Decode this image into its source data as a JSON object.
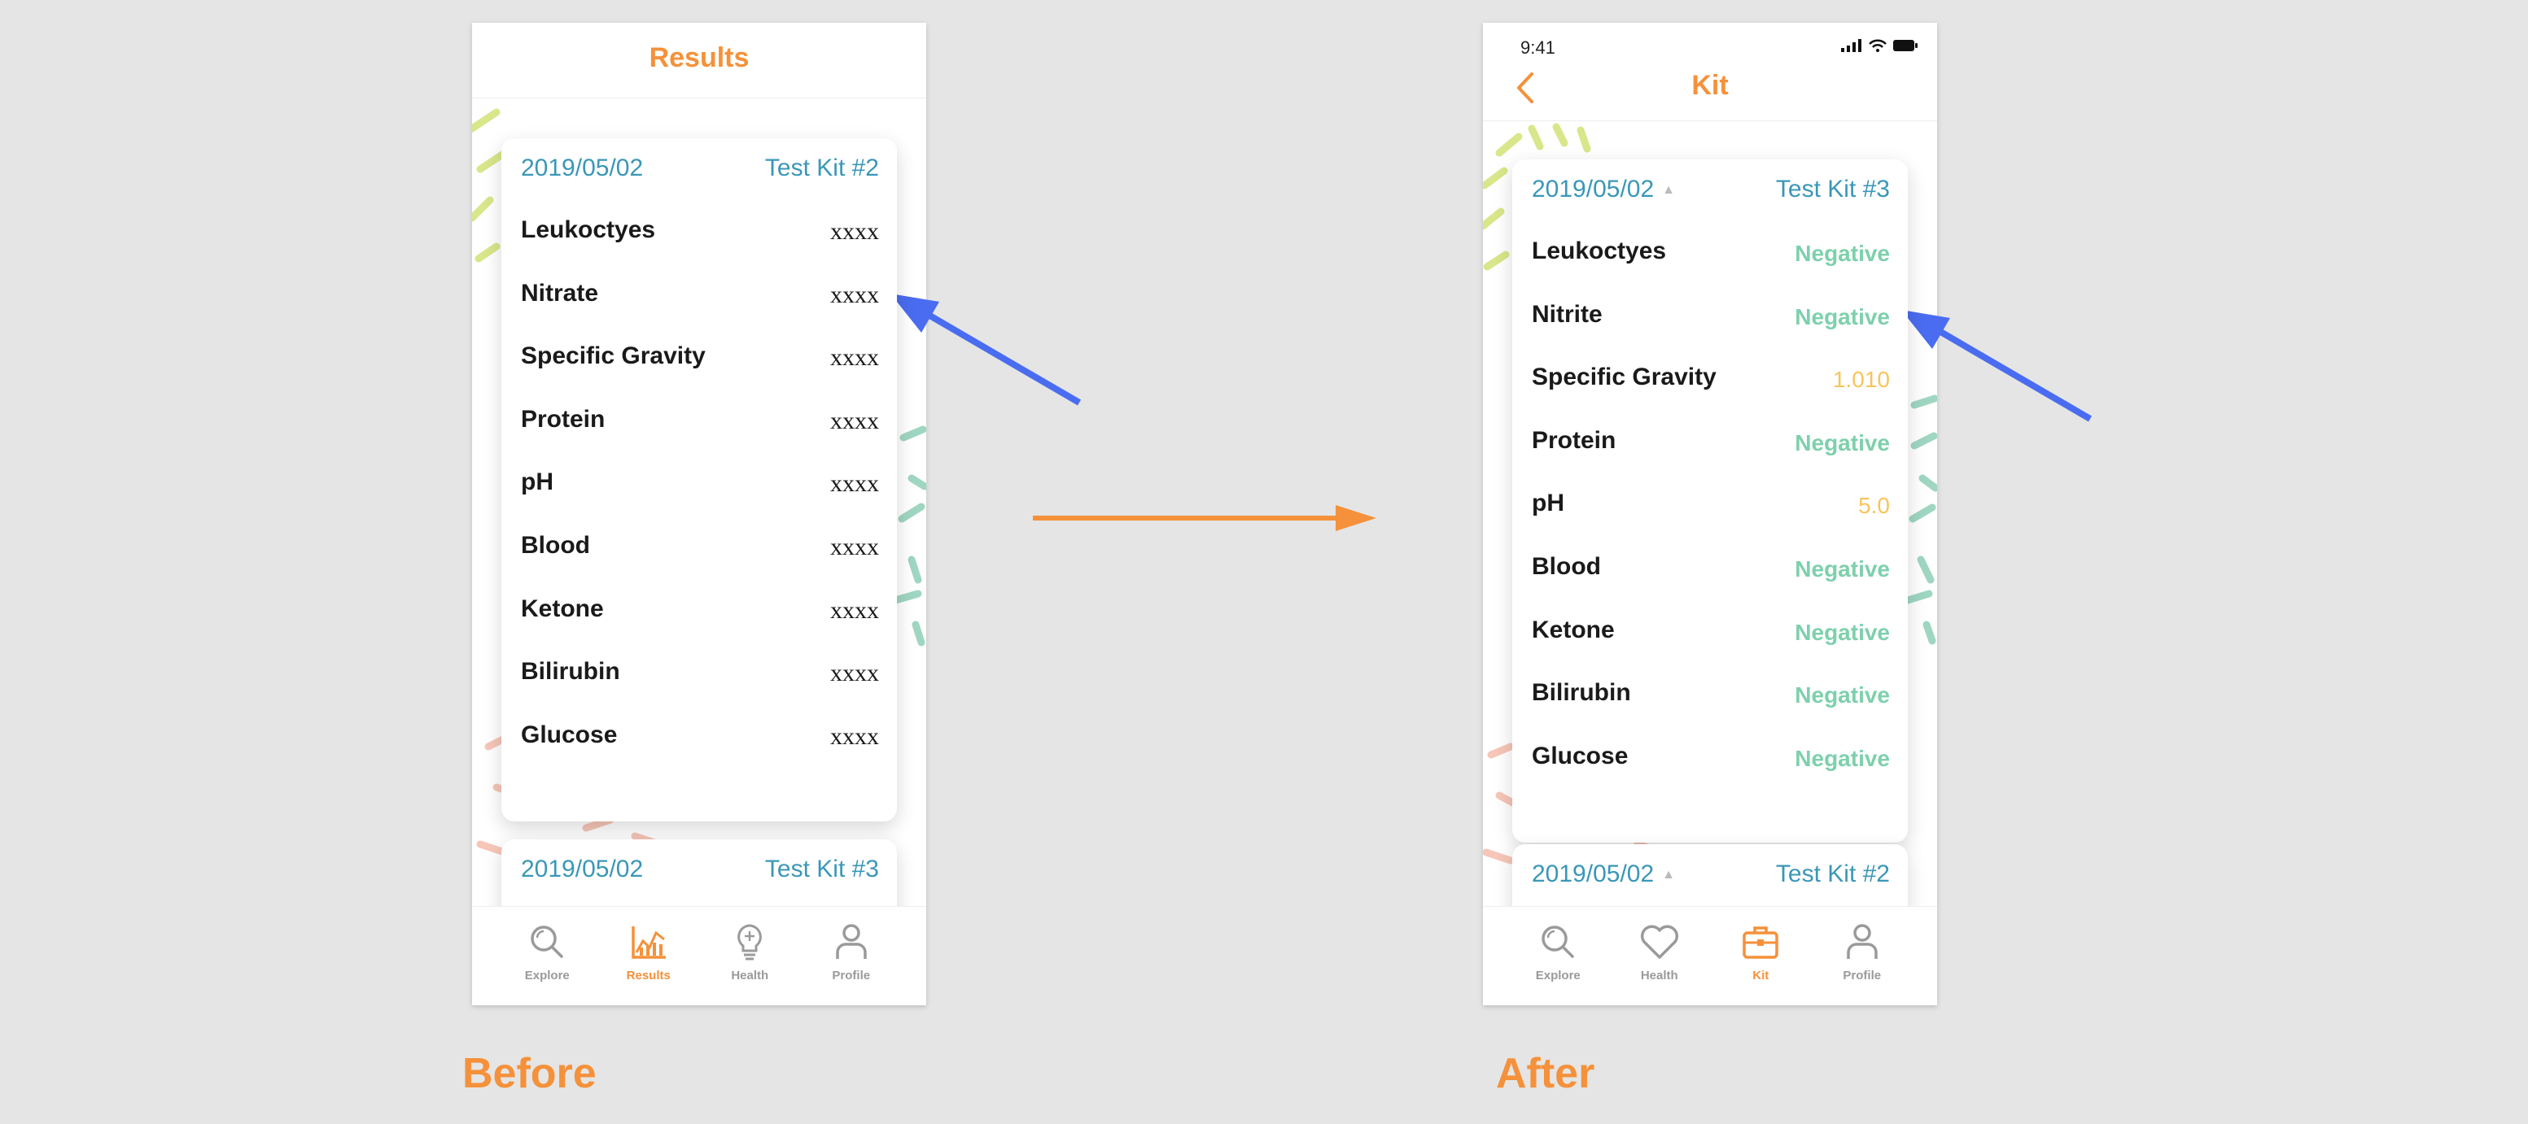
{
  "before": {
    "caption": "Before",
    "header_title": "Results",
    "card_main": {
      "date": "2019/05/02",
      "kit": "Test Kit #2"
    },
    "card_second": {
      "date": "2019/05/02",
      "kit": "Test Kit #3"
    },
    "rows": [
      {
        "label": "Leukoctyes",
        "value": "xxxx"
      },
      {
        "label": "Nitrate",
        "value": "xxxx"
      },
      {
        "label": "Specific Gravity",
        "value": "xxxx"
      },
      {
        "label": "Protein",
        "value": "xxxx"
      },
      {
        "label": "pH",
        "value": "xxxx"
      },
      {
        "label": "Blood",
        "value": "xxxx"
      },
      {
        "label": "Ketone",
        "value": "xxxx"
      },
      {
        "label": "Bilirubin",
        "value": "xxxx"
      },
      {
        "label": "Glucose",
        "value": "xxxx"
      }
    ],
    "tabs": [
      {
        "label": "Explore",
        "icon": "magnifier-icon",
        "active": false
      },
      {
        "label": "Results",
        "icon": "chart-icon",
        "active": true
      },
      {
        "label": "Health",
        "icon": "lightbulb-icon",
        "active": false
      },
      {
        "label": "Profile",
        "icon": "person-icon",
        "active": false
      }
    ]
  },
  "after": {
    "caption": "After",
    "status_time": "9:41",
    "header_title": "Kit",
    "card_main": {
      "date": "2019/05/02",
      "kit": "Test Kit #3"
    },
    "card_second": {
      "date": "2019/05/02",
      "kit": "Test Kit #2"
    },
    "rows": [
      {
        "label": "Leukoctyes",
        "value": "Negative",
        "status": "negative"
      },
      {
        "label": "Nitrite",
        "value": "Negative",
        "status": "negative"
      },
      {
        "label": "Specific Gravity",
        "value": "1.010",
        "status": "numeric"
      },
      {
        "label": "Protein",
        "value": "Negative",
        "status": "negative"
      },
      {
        "label": "pH",
        "value": "5.0",
        "status": "numeric"
      },
      {
        "label": "Blood",
        "value": "Negative",
        "status": "negative"
      },
      {
        "label": "Ketone",
        "value": "Negative",
        "status": "negative"
      },
      {
        "label": "Bilirubin",
        "value": "Negative",
        "status": "negative"
      },
      {
        "label": "Glucose",
        "value": "Negative",
        "status": "negative"
      }
    ],
    "tabs": [
      {
        "label": "Explore",
        "icon": "magnifier-icon",
        "active": false
      },
      {
        "label": "Health",
        "icon": "heart-icon",
        "active": false
      },
      {
        "label": "Kit",
        "icon": "briefcase-icon",
        "active": true
      },
      {
        "label": "Profile",
        "icon": "person-icon",
        "active": false
      }
    ]
  },
  "colors": {
    "accent": "#f5913a",
    "link_blue": "#3a97b8",
    "negative_green": "#7ed0ad",
    "numeric_yellow": "#f7c55a",
    "pointer_arrow": "#4a6cf0",
    "tab_inactive": "#9a9a9a"
  }
}
